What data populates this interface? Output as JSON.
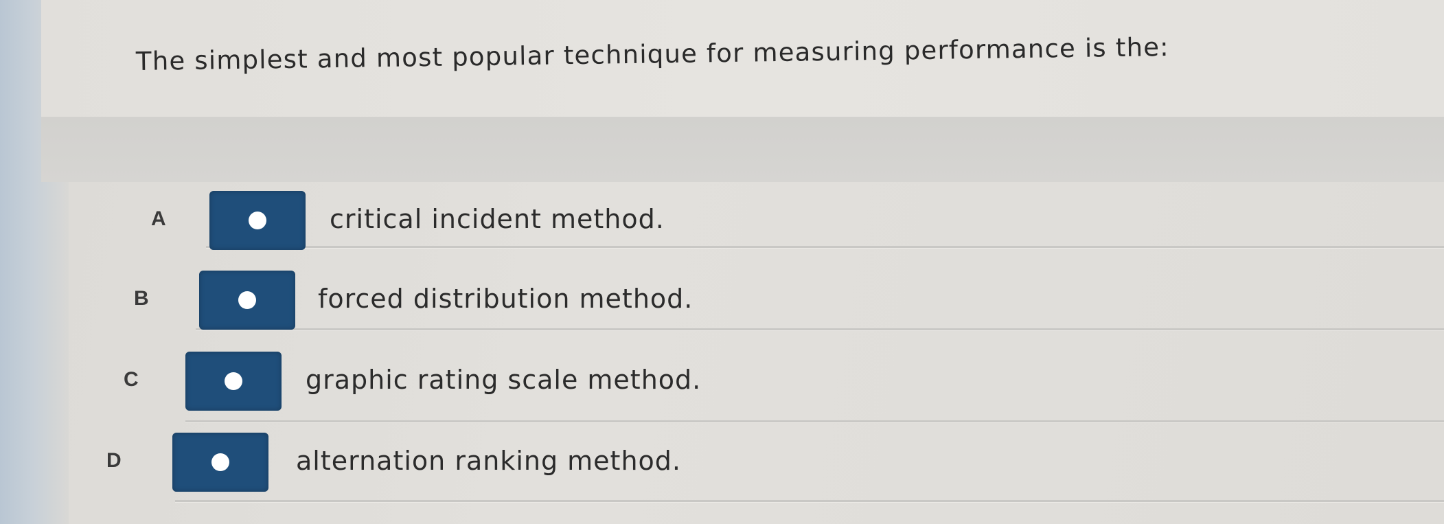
{
  "question": {
    "text": "The simplest and most popular technique for measuring performance is the:"
  },
  "options": [
    {
      "letter": "A",
      "text": "critical incident method."
    },
    {
      "letter": "B",
      "text": "forced distribution method."
    },
    {
      "letter": "C",
      "text": "graphic rating scale method."
    },
    {
      "letter": "D",
      "text": "alternation ranking method."
    }
  ],
  "colors": {
    "option_box": "#1f4e7a",
    "radio_dot": "#ffffff",
    "background": "#e0dfdb"
  }
}
